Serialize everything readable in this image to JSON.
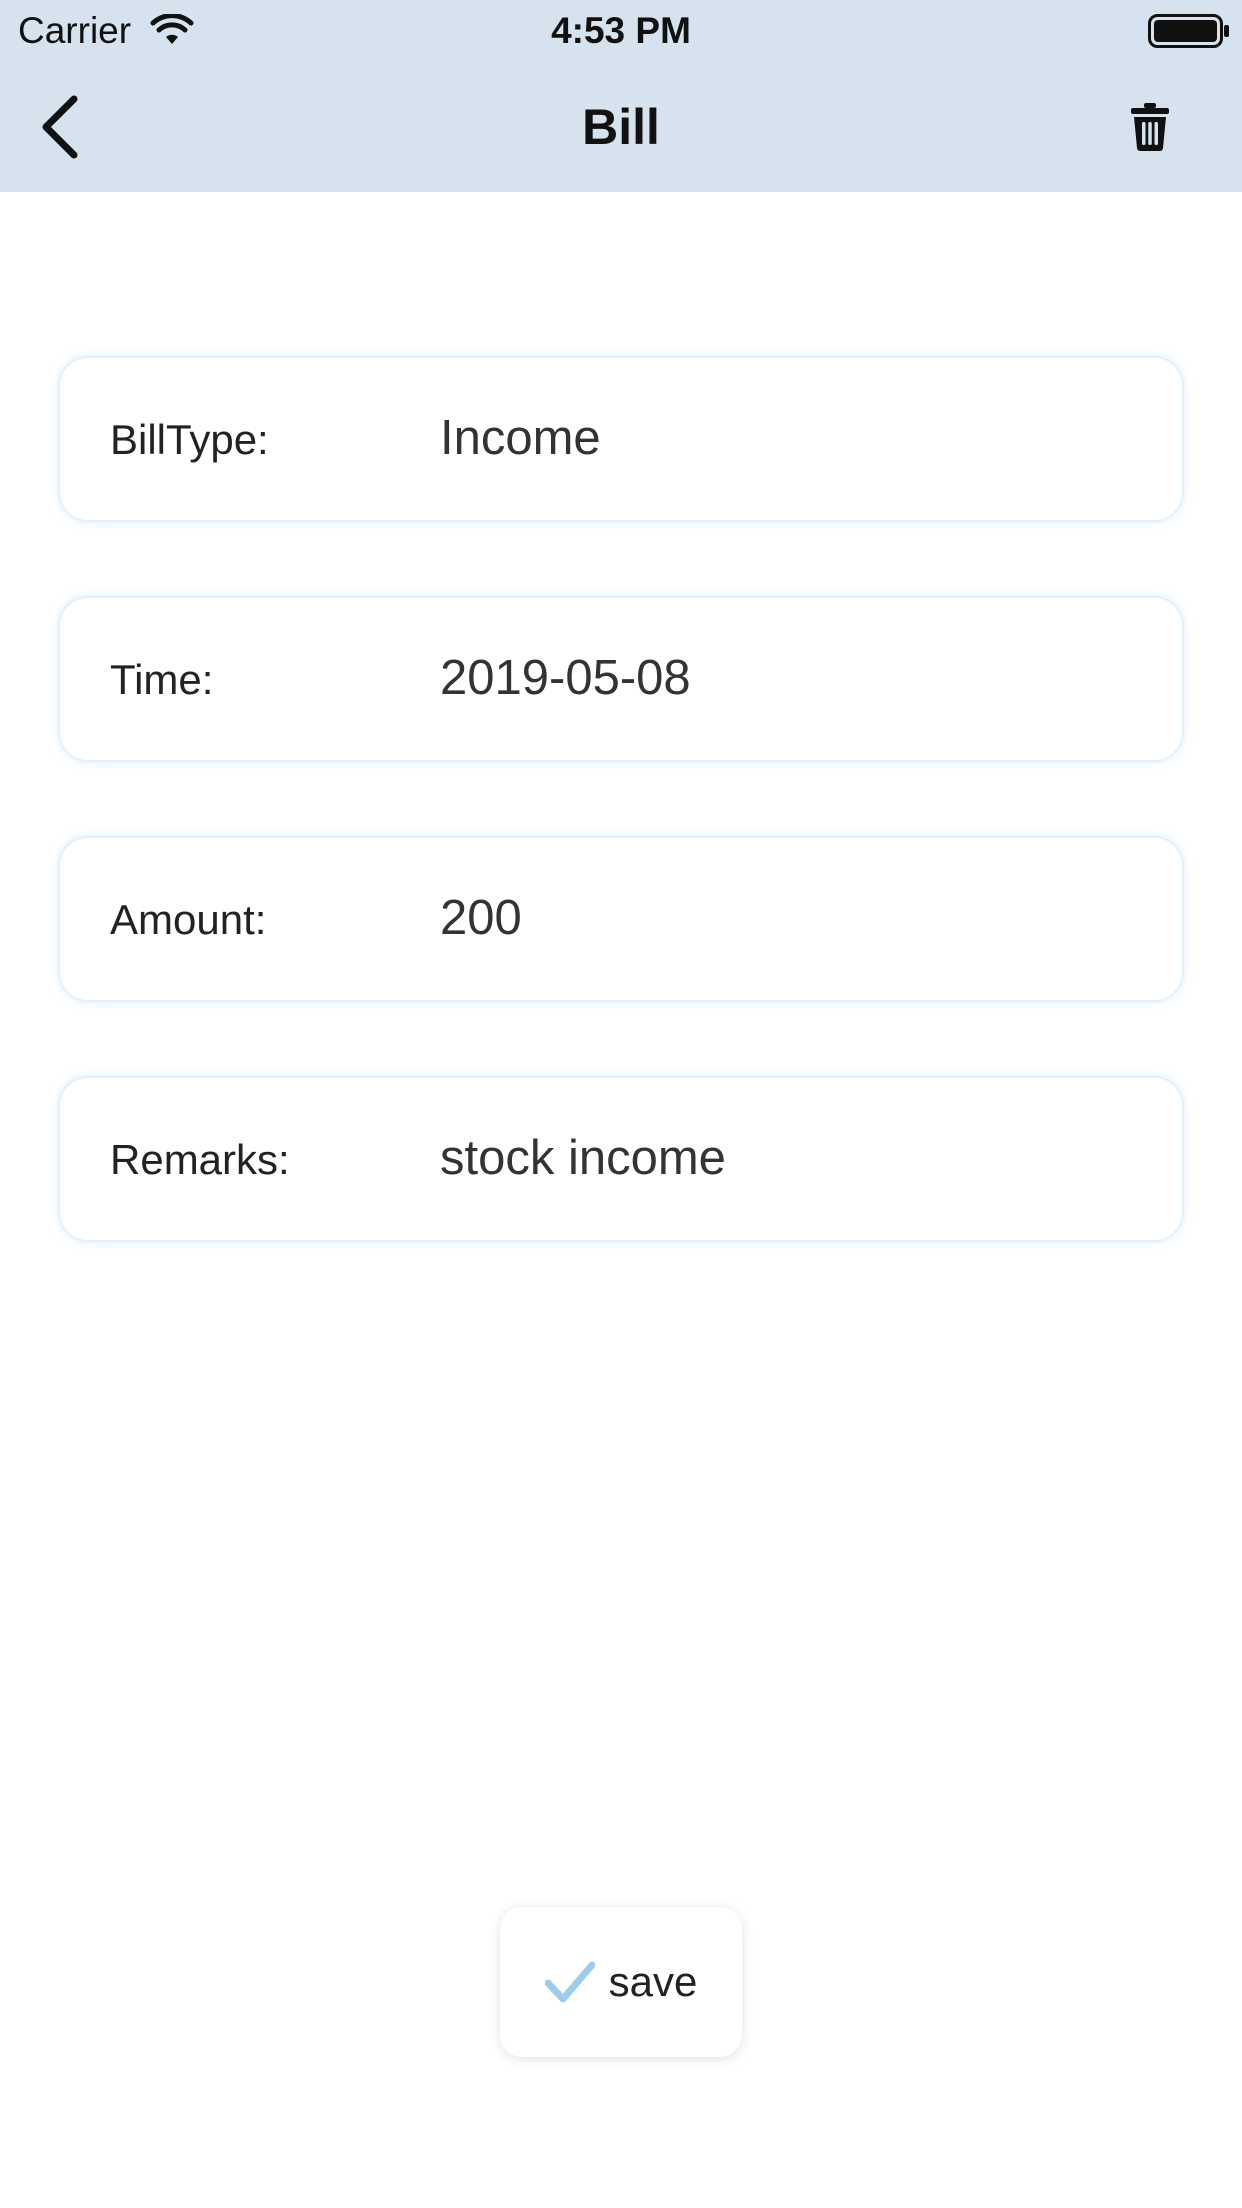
{
  "status_bar": {
    "carrier": "Carrier",
    "time": "4:53 PM",
    "icons": [
      "wifi-icon",
      "battery-icon"
    ]
  },
  "nav": {
    "title": "Bill",
    "back_icon": "chevron-left-icon",
    "delete_icon": "trash-icon"
  },
  "fields": {
    "bill_type": {
      "label": "BillType:",
      "value": "Income"
    },
    "time": {
      "label": "Time:",
      "value": "2019-05-08"
    },
    "amount": {
      "label": "Amount:",
      "value": "200"
    },
    "remarks": {
      "label": "Remarks:",
      "value": "stock income"
    }
  },
  "save_button": {
    "label": "save",
    "icon": "check-icon"
  },
  "colors": {
    "header_bg": "#d6e3ef",
    "card_border": "#e3f1fc",
    "check_accent": "#9dcdeb"
  }
}
